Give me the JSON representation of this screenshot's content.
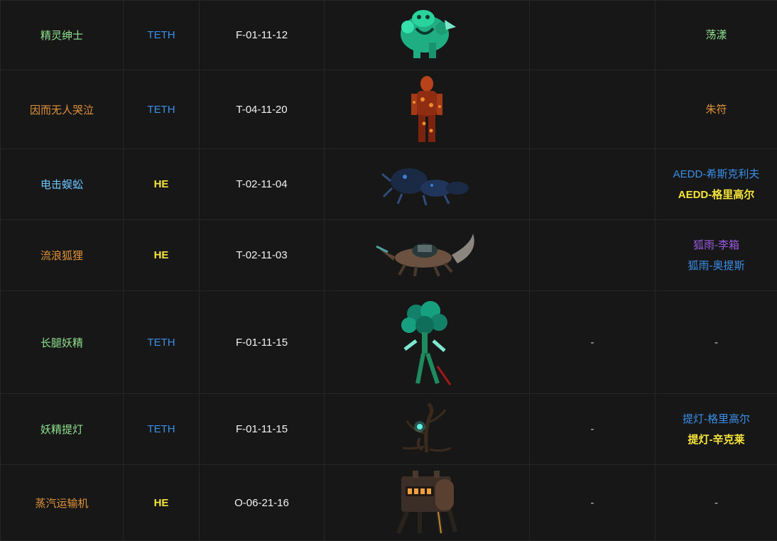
{
  "colors": {
    "green": "#8fe28f",
    "orange": "#e0923a",
    "blue": "#6cc6ff",
    "teth": "#3a8fe8",
    "he": "#f7e43a",
    "purple": "#9a5be0",
    "background": "#171717"
  },
  "rows": [
    {
      "name": "精灵绅士",
      "level": "TETH",
      "code": "F-01-11-12",
      "image_icon": "green-frog-gentleman-icon",
      "col5": "",
      "gifts": [
        "荡漾"
      ]
    },
    {
      "name": "因而无人哭泣",
      "level": "TETH",
      "code": "T-04-11-20",
      "image_icon": "orange-scaled-figure-icon",
      "col5": "",
      "gifts": [
        "朱符"
      ]
    },
    {
      "name": "电击蜈蚣",
      "level": "HE",
      "code": "T-02-11-04",
      "image_icon": "dark-blue-centipede-icon",
      "col5": "",
      "gifts": [
        "AEDD-希斯克利夫",
        "AEDD-格里高尔"
      ]
    },
    {
      "name": "流浪狐狸",
      "level": "HE",
      "code": "T-02-11-03",
      "image_icon": "wandering-fox-icon",
      "col5": "",
      "gifts": [
        "狐雨-李箱",
        "狐雨-奥提斯"
      ]
    },
    {
      "name": "长腿妖精",
      "level": "TETH",
      "code": "F-01-11-15",
      "image_icon": "long-leg-fairy-icon",
      "col5": "-",
      "gifts": [
        "-"
      ]
    },
    {
      "name": "妖精提灯",
      "level": "TETH",
      "code": "F-01-11-15",
      "image_icon": "fairy-lantern-tree-icon",
      "col5": "-",
      "gifts": [
        "提灯-格里高尔",
        "提灯-辛克莱"
      ]
    },
    {
      "name": "蒸汽运输机",
      "level": "HE",
      "code": "O-06-21-16",
      "image_icon": "steam-transport-machine-icon",
      "col5": "-",
      "gifts": [
        "-"
      ]
    }
  ]
}
